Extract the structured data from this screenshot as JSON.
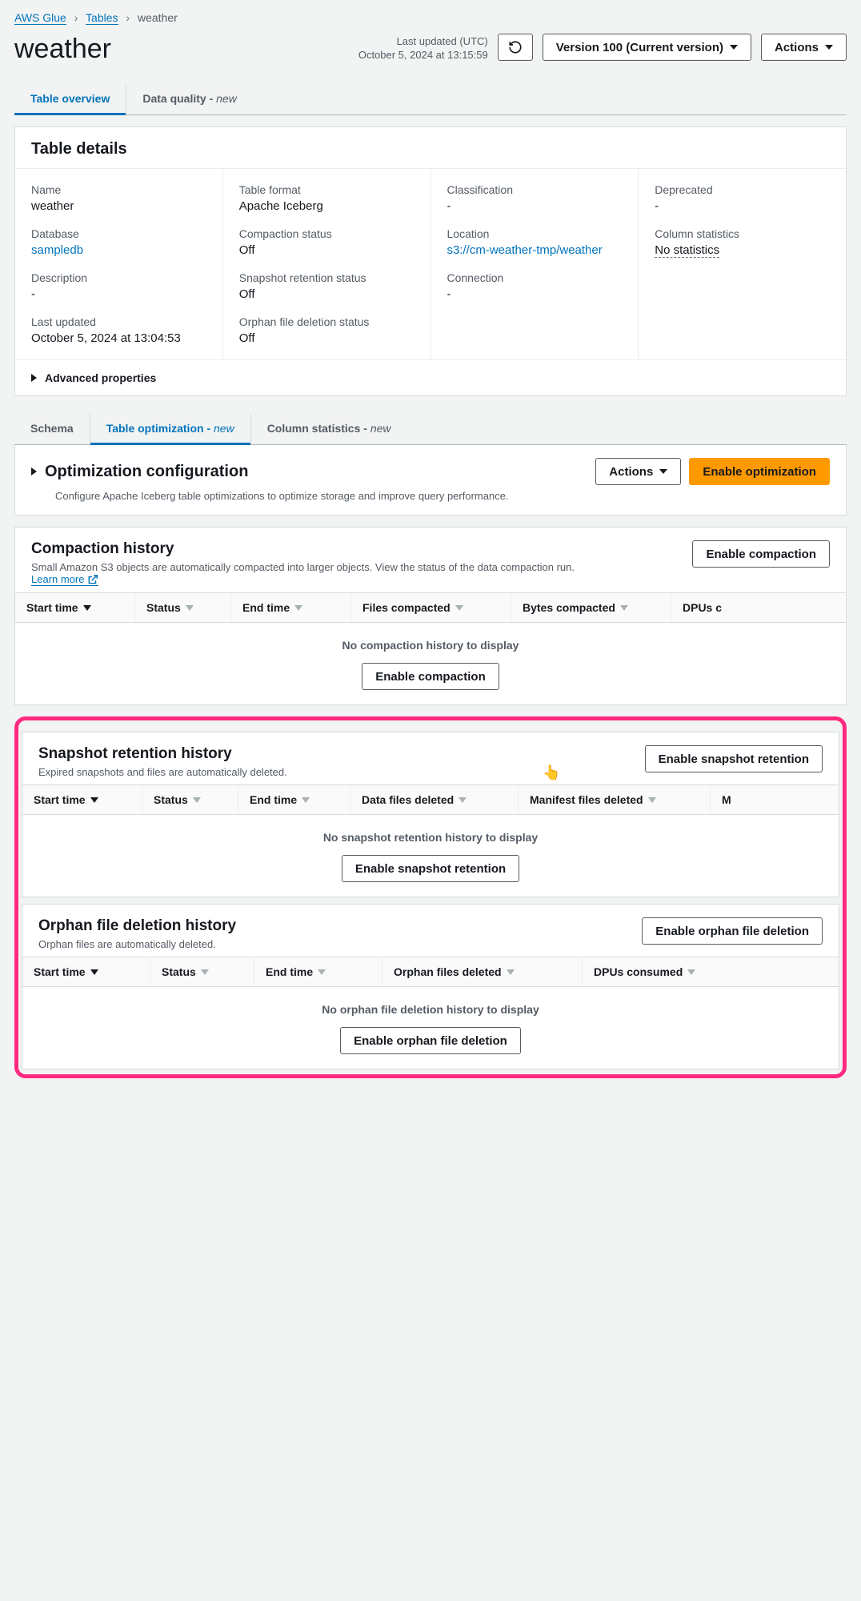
{
  "breadcrumb": {
    "root": "AWS Glue",
    "tables": "Tables",
    "current": "weather"
  },
  "header": {
    "title": "weather",
    "last_updated_label": "Last updated (UTC)",
    "last_updated_value": "October 5, 2024 at 13:15:59",
    "version_btn": "Version 100 (Current version)",
    "actions_btn": "Actions"
  },
  "main_tabs": {
    "overview": "Table overview",
    "data_quality": "Data quality - ",
    "new_suffix": "new"
  },
  "table_details": {
    "heading": "Table details",
    "col1": {
      "name_label": "Name",
      "name_value": "weather",
      "database_label": "Database",
      "database_value": "sampledb",
      "description_label": "Description",
      "description_value": "-",
      "last_updated_label": "Last updated",
      "last_updated_value": "October 5, 2024 at 13:04:53"
    },
    "col2": {
      "format_label": "Table format",
      "format_value": "Apache Iceberg",
      "compaction_label": "Compaction status",
      "compaction_value": "Off",
      "snapshot_label": "Snapshot retention status",
      "snapshot_value": "Off",
      "orphan_label": "Orphan file deletion status",
      "orphan_value": "Off"
    },
    "col3": {
      "classification_label": "Classification",
      "classification_value": "-",
      "location_label": "Location",
      "location_value": "s3://cm-weather-tmp/weather",
      "connection_label": "Connection",
      "connection_value": "-"
    },
    "col4": {
      "deprecated_label": "Deprecated",
      "deprecated_value": "-",
      "colstats_label": "Column statistics",
      "colstats_value": "No statistics"
    },
    "advanced": "Advanced properties"
  },
  "sub_tabs": {
    "schema": "Schema",
    "opt": "Table optimization - ",
    "colstats": "Column statistics - ",
    "new_suffix": "new"
  },
  "optimization": {
    "title": "Optimization configuration",
    "desc": "Configure Apache Iceberg table optimizations to optimize storage and improve query performance.",
    "actions_btn": "Actions",
    "enable_btn": "Enable optimization"
  },
  "compaction": {
    "title": "Compaction history",
    "desc": "Small Amazon S3 objects are automatically compacted into larger objects. View the status of the data compaction run.",
    "learn_more": "Learn more",
    "enable_btn": "Enable compaction",
    "cols": {
      "c0": "Start time",
      "c1": "Status",
      "c2": "End time",
      "c3": "Files compacted",
      "c4": "Bytes compacted",
      "c5": "DPUs c"
    },
    "empty": "No compaction history to display"
  },
  "snapshot": {
    "title": "Snapshot retention history",
    "desc": "Expired snapshots and files are automatically deleted.",
    "enable_btn": "Enable snapshot retention",
    "cols": {
      "c0": "Start time",
      "c1": "Status",
      "c2": "End time",
      "c3": "Data files deleted",
      "c4": "Manifest files deleted",
      "c5": "M"
    },
    "empty": "No snapshot retention history to display"
  },
  "orphan": {
    "title": "Orphan file deletion history",
    "desc": "Orphan files are automatically deleted.",
    "enable_btn": "Enable orphan file deletion",
    "cols": {
      "c0": "Start time",
      "c1": "Status",
      "c2": "End time",
      "c3": "Orphan files deleted",
      "c4": "DPUs consumed"
    },
    "empty": "No orphan file deletion history to display"
  }
}
